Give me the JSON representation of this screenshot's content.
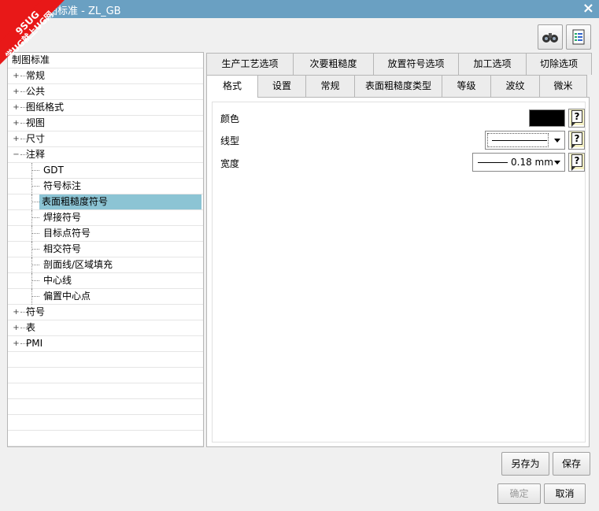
{
  "window": {
    "title": "图标准 - ZL_GB",
    "close": "×"
  },
  "watermark": {
    "top": "9SUG",
    "bottom": "学UG就上UG网"
  },
  "toolbar": {
    "icons": [
      "binoculars-icon",
      "settings-sheet-icon"
    ]
  },
  "tree": {
    "root": "制图标准",
    "items": [
      {
        "label": "常规",
        "expander": "+"
      },
      {
        "label": "公共",
        "expander": "+"
      },
      {
        "label": "图纸格式",
        "expander": "+"
      },
      {
        "label": "视图",
        "expander": "+"
      },
      {
        "label": "尺寸",
        "expander": "+"
      },
      {
        "label": "注释",
        "expander": "−"
      }
    ],
    "children": [
      "GDT",
      "符号标注",
      "表面粗糙度符号",
      "焊接符号",
      "目标点符号",
      "相交符号",
      "剖面线/区域填充",
      "中心线",
      "偏置中心点"
    ],
    "selected": "表面粗糙度符号",
    "items_after": [
      {
        "label": "符号",
        "expander": "+"
      },
      {
        "label": "表",
        "expander": "+"
      },
      {
        "label": "PMI",
        "expander": "+"
      }
    ]
  },
  "tabs": {
    "row1": [
      "生产工艺选项",
      "次要粗糙度",
      "放置符号选项",
      "加工选项",
      "切除选项"
    ],
    "row2": [
      "格式",
      "设置",
      "常规",
      "表面粗糙度类型",
      "等级",
      "波纹",
      "微米"
    ],
    "active": "格式"
  },
  "format": {
    "color_label": "颜色",
    "color_value": "#000000",
    "linetype_label": "线型",
    "width_label": "宽度",
    "width_value": "0.18 mm",
    "help_glyph": "?"
  },
  "buttons": {
    "save_as": "另存为",
    "save": "保存",
    "ok": "确定",
    "cancel": "取消"
  }
}
